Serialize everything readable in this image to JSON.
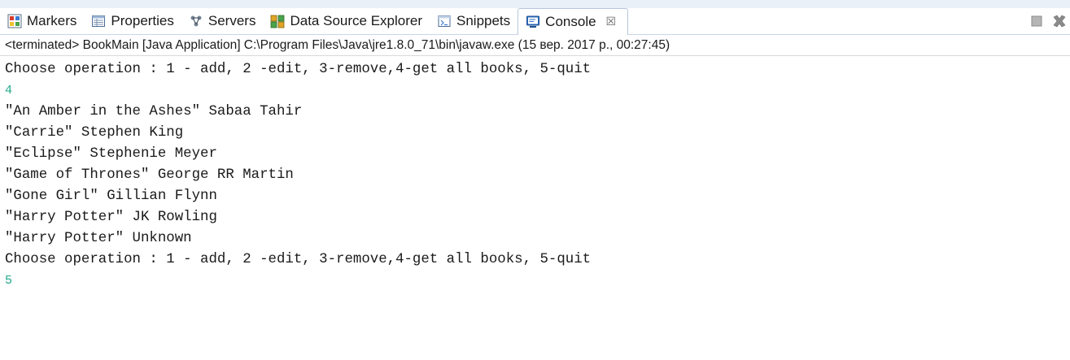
{
  "tabs": [
    {
      "label": "Markers",
      "icon": "markers-icon"
    },
    {
      "label": "Properties",
      "icon": "properties-icon"
    },
    {
      "label": "Servers",
      "icon": "servers-icon"
    },
    {
      "label": "Data Source Explorer",
      "icon": "data-source-explorer-icon"
    },
    {
      "label": "Snippets",
      "icon": "snippets-icon"
    },
    {
      "label": "Console",
      "icon": "console-icon",
      "active": true,
      "close": "☒"
    }
  ],
  "status": "<terminated> BookMain [Java Application] C:\\Program Files\\Java\\jre1.8.0_71\\bin\\javaw.exe (15 вер. 2017 р., 00:27:45)",
  "console": {
    "lines": [
      {
        "text": "Choose operation : 1 - add, 2 -edit, 3-remove,4-get all books, 5-quit",
        "kind": "output"
      },
      {
        "text": "4",
        "kind": "input"
      },
      {
        "text": "\"An Amber in the Ashes\" Sabaa Tahir",
        "kind": "output"
      },
      {
        "text": "\"Carrie\" Stephen King",
        "kind": "output"
      },
      {
        "text": "\"Eclipse\" Stephenie Meyer",
        "kind": "output"
      },
      {
        "text": "\"Game of Thrones\" George RR Martin",
        "kind": "output"
      },
      {
        "text": "\"Gone Girl\" Gillian Flynn",
        "kind": "output"
      },
      {
        "text": "\"Harry Potter\" JK Rowling",
        "kind": "output"
      },
      {
        "text": "\"Harry Potter\" Unknown",
        "kind": "output"
      },
      {
        "text": "Choose operation : 1 - add, 2 -edit, 3-remove,4-get all books, 5-quit",
        "kind": "output"
      },
      {
        "text": "5",
        "kind": "input"
      }
    ]
  },
  "colors": {
    "input_text": "#1fa88a",
    "tab_border": "#b7c7dc",
    "top_strip": "#eaf0f8"
  }
}
